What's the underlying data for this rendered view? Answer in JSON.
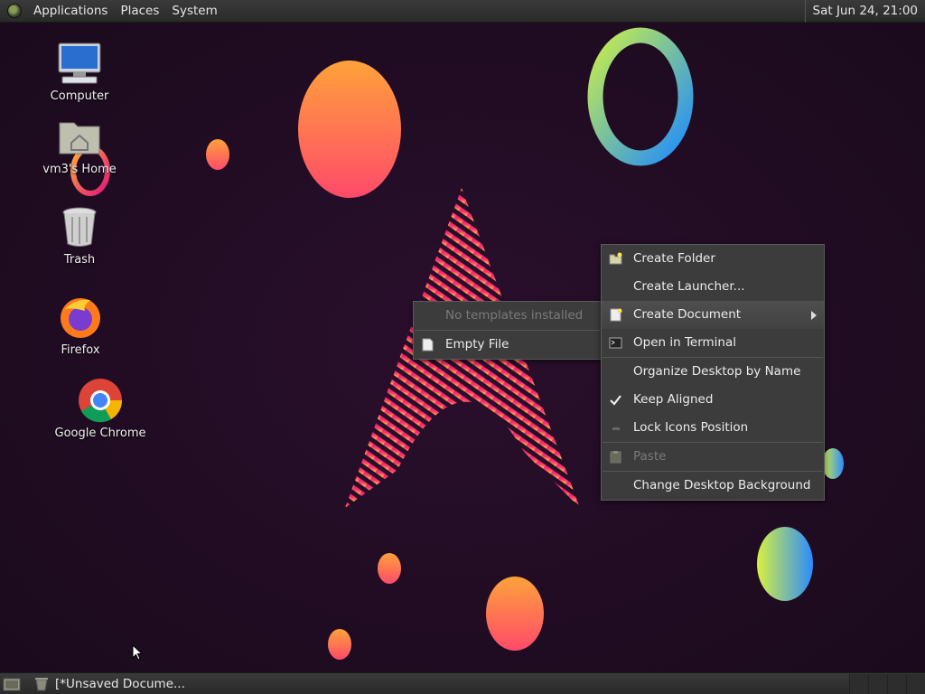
{
  "top_panel": {
    "menus": [
      "Applications",
      "Places",
      "System"
    ],
    "clock": "Sat Jun 24, 21:00"
  },
  "desktop_icons": [
    {
      "label": "Computer",
      "icon": "computer-icon"
    },
    {
      "label": "vm3's Home",
      "icon": "home-folder-icon"
    },
    {
      "label": "Trash",
      "icon": "trash-icon"
    },
    {
      "label": "Firefox",
      "icon": "firefox-icon"
    },
    {
      "label": "Google Chrome",
      "icon": "chrome-icon"
    }
  ],
  "context_menu": {
    "items": [
      {
        "label": "Create Folder",
        "icon": "folder-new-icon"
      },
      {
        "label": "Create Launcher...",
        "icon": ""
      },
      {
        "label": "Create Document",
        "icon": "document-new-icon",
        "submenu": true,
        "selected": true
      },
      {
        "label": "Open in Terminal",
        "icon": "terminal-icon"
      },
      {
        "label": "Organize Desktop by Name",
        "icon": ""
      },
      {
        "label": "Keep Aligned",
        "icon": "check-icon",
        "checked": true
      },
      {
        "label": "Lock Icons Position",
        "icon": "lock-icon"
      },
      {
        "label": "Paste",
        "icon": "paste-icon",
        "disabled": true
      },
      {
        "label": "Change Desktop Background",
        "icon": ""
      }
    ]
  },
  "submenu": {
    "items": [
      {
        "label": "No templates installed",
        "disabled": true
      },
      {
        "label": "Empty File",
        "icon": "document-icon"
      }
    ]
  },
  "bottom_panel": {
    "task_label": "[*Unsaved Docume..."
  },
  "colors": {
    "background": "#220c24",
    "menu_bg": "#3c3c3c",
    "panel_bg": "#2f2f2f"
  }
}
